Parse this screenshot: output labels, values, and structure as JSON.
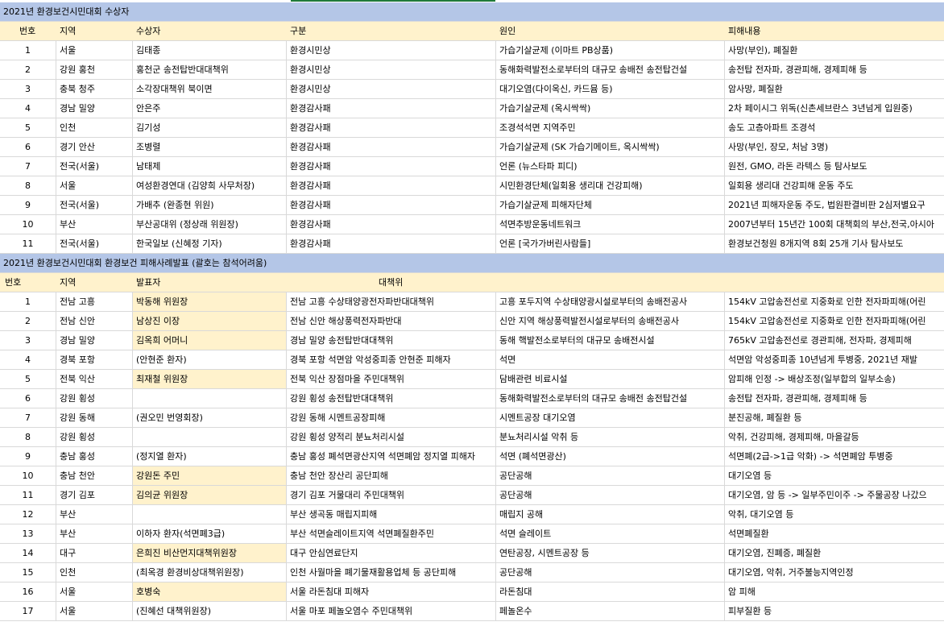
{
  "section1": {
    "title": "2021년 환경보건시민대회 수상자",
    "headers": [
      "번호",
      "지역",
      "수상자",
      "구분",
      "원인",
      "피해내용"
    ],
    "rows": [
      [
        "1",
        "서울",
        "김태종",
        "환경시민상",
        "가습기살균제 (이마트 PB상품)",
        "사망(부인), 폐질환"
      ],
      [
        "2",
        "강원 홍천",
        "홍천군 송전탑반대대책위",
        "환경시민상",
        "동해화력발전소로부터의 대규모 송배전 송전탑건설",
        "송전탑 전자파, 경관피해, 경제피해 등"
      ],
      [
        "3",
        "충북 청주",
        "소각장대책위 북이면",
        "환경시민상",
        "대기오염(다이옥신, 카드뮴 등)",
        "암사망, 폐질환"
      ],
      [
        "4",
        "경남 밀양",
        "안은주",
        "환경감사패",
        "가습기살균제 (옥시싹싹)",
        "2차 페이시그 위독(신촌세브란스 3년넘게 입원중)"
      ],
      [
        "5",
        "인천",
        "김기성",
        "환경감사패",
        "조경석석면 지역주민",
        "송도 고층아파트 조경석"
      ],
      [
        "6",
        "경기 안산",
        "조병렬",
        "환경감사패",
        "가습기살균제 (SK 가습기메이트, 옥시싹싹)",
        "사망(부인, 장모, 처남 3명)"
      ],
      [
        "7",
        "전국(서울)",
        "남태제",
        "환경감사패",
        "언론 (뉴스타파 피디)",
        "원전, GMO, 라돈 라텍스 등 탐사보도"
      ],
      [
        "8",
        "서울",
        "여성환경연대 (김양희 사무처장)",
        "환경감사패",
        "시민환경단체(일회용 생리대 건강피해)",
        "일회용 생리대 건강피해 운동 주도"
      ],
      [
        "9",
        "전국(서울)",
        "가배추 (완종현 위원)",
        "환경감사패",
        "가습기살균제 피해자단체",
        "2021년 피해자운동 주도, 법원판결비판 2심저별요구"
      ],
      [
        "10",
        "부산",
        "부산공대위 (정상래 위원장)",
        "환경감사패",
        "석면추방운동네트워크",
        "2007년부터 15년간 100회 대책회의 부산,전국,아시아"
      ],
      [
        "11",
        "전국(서울)",
        "한국일보 (신혜정 기자)",
        "환경감사패",
        "언론 [국가가버린사람들]",
        "환경보건청원 8개지역 8회 25개 기사 탐사보도"
      ]
    ]
  },
  "section2": {
    "title": "2021년 환경보건시민대회 환경보건 피해사례발표 (괄호는 참석어려움)",
    "headers": [
      "번호",
      "지역",
      "발표자",
      "대책위",
      "",
      ""
    ],
    "rows": [
      [
        "1",
        "전남 고흥",
        "박동해 위원장",
        "전남 고흥 수상태양광전자파반대대책위",
        "고흥 포두지역 수상태양광시설로부터의 송배전공사",
        "154kV 고압송전선로 지중화로 인한 전자파피해(어린"
      ],
      [
        "2",
        "전남 신안",
        "남상진 이장",
        "전남 신안 해상풍력전자파반대",
        "신안 지역 해상풍력발전시설로부터의 송배전공사",
        "154kV 고압송전선로 지중화로 인한 전자파피해(어린"
      ],
      [
        "3",
        "경남 밀양",
        "김옥희 어머니",
        "경남 밀양 송전탑반대대책위",
        "동해 핵발전소로부터의 대규모 송배전시설",
        "765kV 고압송전선로 경관피해, 전자파, 경제피해"
      ],
      [
        "4",
        "경북 포항",
        "(안현준 환자)",
        "경북 포항 석면암 악성중피종 안현준 피해자",
        "석면",
        "석면암 악성중피종 10년넘게 투병중, 2021년 재발"
      ],
      [
        "5",
        "전북 익산",
        "최재철 위원장",
        "전북 익산 장점마을 주민대책위",
        "담배관련 비료시설",
        "암피해 인정 -> 배상조정(일부합의 일부소송)"
      ],
      [
        "6",
        "강원 횡성",
        "",
        "강원 횡성 송전탑반대대책위",
        "동해화력발전소로부터의 대규모 송배전 송전탑건설",
        "송전탑 전자파, 경관피해, 경제피해 등"
      ],
      [
        "7",
        "강원 동해",
        "(권오민 번영회장)",
        "강원 동해 시멘트공장피해",
        "시멘트공장 대기오염",
        "분진공해, 폐질환 등"
      ],
      [
        "8",
        "강원 횡성",
        "",
        "강원 횡성 양적리 분뇨처리시설",
        "분뇨처리시설 악취 등",
        "악취, 건강피해, 경제피해, 마을갈등"
      ],
      [
        "9",
        "충남 홍성",
        "(정지열 환자)",
        "충남 홍성 폐석면광산지역 석면폐암 정지열 피해자",
        "석면 (폐석면광산)",
        "석면폐(2급->1급 악화) -> 석면폐암 투병중"
      ],
      [
        "10",
        "충남 천안",
        "강원돈 주민",
        "충남 천안 장산리 공단피해",
        "공단공해",
        "대기오염 등"
      ],
      [
        "11",
        "경기 김포",
        "김의균 위원장",
        "경기 김포 거물대리 주민대책위",
        "공단공해",
        "대기오염, 암 등 -> 일부주민이주 -> 주물공장 나갔으"
      ],
      [
        "12",
        "부산",
        "",
        "부산 생곡동 매립지피해",
        "매립지 공해",
        "악취, 대기오염 등"
      ],
      [
        "13",
        "부산",
        "이하자 환자(석면폐3급)",
        "부산 석면슬레이트지역 석면폐질환주민",
        "석면 슬레이트",
        "석면폐질환"
      ],
      [
        "14",
        "대구",
        "은희진 비산먼지대책위원장",
        "대구 안심연료단지",
        "연탄공장, 시멘트공장 등",
        "대기오염, 진폐증, 폐질환"
      ],
      [
        "15",
        "인천",
        "(최옥경 환경비상대책위원장)",
        "인천 사월마을 폐기물재활용업체 등 공단피해",
        "공단공해",
        "대기오염, 악취, 거주불능지역인정"
      ],
      [
        "16",
        "서울",
        "호병숙",
        "서울 라돈침대 피해자",
        "라돈침대",
        "암 피해"
      ],
      [
        "17",
        "서울",
        "(진혜선 대책위원장)",
        "서울 마포 페놀오염수 주민대책위",
        "페놀온수",
        "피부질환 등"
      ]
    ],
    "highlighted_presenters": [
      1,
      2,
      3,
      5,
      10,
      11,
      14,
      16
    ]
  },
  "colors": {
    "banner": "#b4c6e7",
    "header": "#fff2cc",
    "highlight": "#fff2cc",
    "grid": "#d9d9d9"
  }
}
